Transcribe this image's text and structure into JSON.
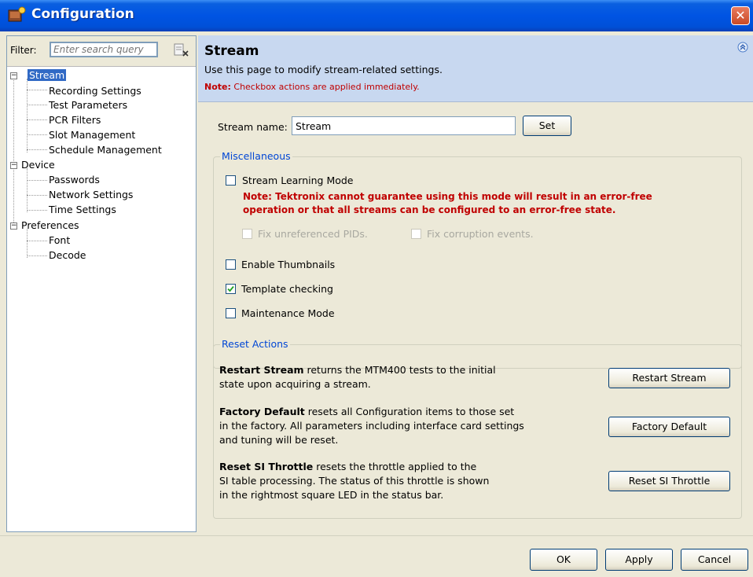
{
  "window": {
    "title": "Configuration",
    "close_label": "✕"
  },
  "filter": {
    "label": "Filter:",
    "placeholder": "Enter search query"
  },
  "tree": {
    "stream": {
      "label": "Stream",
      "children": [
        "Recording Settings",
        "Test Parameters",
        "PCR Filters",
        "Slot Management",
        "Schedule Management"
      ]
    },
    "device": {
      "label": "Device",
      "children": [
        "Passwords",
        "Network Settings",
        "Time Settings"
      ]
    },
    "preferences": {
      "label": "Preferences",
      "children": [
        "Font",
        "Decode"
      ]
    }
  },
  "page": {
    "title": "Stream",
    "description": "Use this page to modify stream-related settings.",
    "note_label": "Note:",
    "note_text": "Checkbox actions are applied immediately."
  },
  "stream_name": {
    "label": "Stream name:",
    "value": "Stream",
    "set_button": "Set"
  },
  "misc": {
    "title": "Miscellaneous",
    "learning_mode": {
      "label": "Stream Learning Mode",
      "checked": false
    },
    "warning_line1": "Note: Tektronix cannot guarantee using this mode will result in an error-free",
    "warning_line2": "operation or that all streams can be configured to an error-free state.",
    "fix_pids": {
      "label": "Fix unreferenced PIDs.",
      "checked": false,
      "enabled": false
    },
    "fix_corruption": {
      "label": "Fix corruption events.",
      "checked": false,
      "enabled": false
    },
    "thumbnails": {
      "label": "Enable Thumbnails",
      "checked": false
    },
    "template": {
      "label": "Template checking",
      "checked": true
    },
    "maintenance": {
      "label": "Maintenance Mode",
      "checked": false
    }
  },
  "reset": {
    "title": "Reset Actions",
    "restart": {
      "bold": "Restart Stream",
      "line1": " returns the MTM400 tests to the initial",
      "line2": "state upon acquiring a stream.",
      "button": "Restart Stream"
    },
    "factory": {
      "bold": "Factory Default",
      "line1": " resets all Configuration items to those set",
      "line2": "in the factory. All parameters including interface card settings",
      "line3": "and tuning will be reset.",
      "button": "Factory Default"
    },
    "si": {
      "bold": "Reset SI Throttle",
      "line1": " resets the throttle applied to the",
      "line2": "SI table processing. The status of this throttle is shown",
      "line3": "in the rightmost square LED in the status bar.",
      "button": "Reset SI Throttle"
    }
  },
  "footer": {
    "ok": "OK",
    "apply": "Apply",
    "cancel": "Cancel"
  }
}
